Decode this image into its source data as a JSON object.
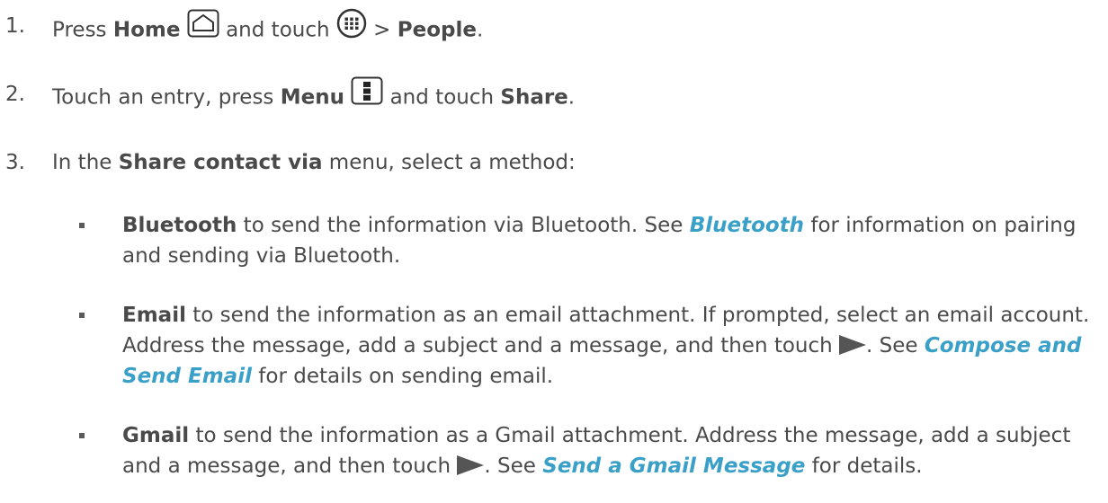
{
  "steps": [
    {
      "num": "1.",
      "t1": "Press ",
      "b1": "Home",
      "t2": " and touch ",
      "t3": " > ",
      "b2": "People",
      "t4": "."
    },
    {
      "num": "2.",
      "t1": "Touch an entry, press ",
      "b1": "Menu",
      "t2": " and touch ",
      "b2": "Share",
      "t3": "."
    },
    {
      "num": "3.",
      "t1": "In the ",
      "b1": "Share contact via",
      "t2": " menu, select a method:"
    }
  ],
  "bullets": [
    {
      "b": "Bluetooth",
      "t1": " to send the information via Bluetooth. See ",
      "link": "Bluetooth",
      "t2": " for information on pairing and sending via Bluetooth."
    },
    {
      "b": "Email",
      "t1": " to send the information as an email attachment. If prompted, select an email account. Address the message, add a subject and a message, and then touch ",
      "t2": ". See ",
      "link": "Compose and Send Email",
      "t3": " for details on sending email."
    },
    {
      "b": "Gmail",
      "t1": " to send the information as a Gmail attachment. Address the message, add a subject and a message, and then touch ",
      "t2": ". See ",
      "link": "Send a Gmail Message",
      "t3": " for details."
    }
  ],
  "icons": {
    "home": "home-button-icon",
    "apps": "apps-grid-icon",
    "menu": "menu-button-icon",
    "send": "send-arrow-icon"
  },
  "colors": {
    "text": "#4a4a4a",
    "link": "#3aa0c8"
  }
}
